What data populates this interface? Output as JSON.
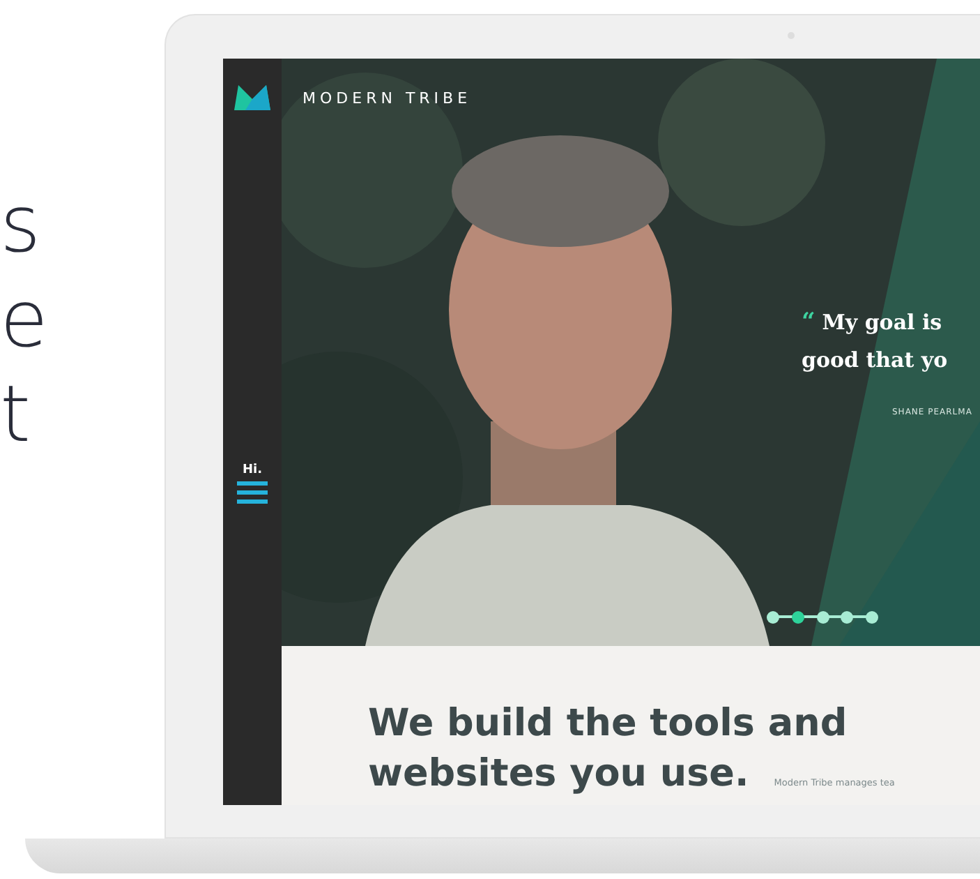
{
  "side_text": [
    "s",
    "e",
    "t"
  ],
  "logo": {
    "text": "MODERN TRIBE"
  },
  "menu": {
    "label": "Hi."
  },
  "quote": {
    "mark": "“",
    "lines": [
      "My goal is",
      "good that yo"
    ],
    "author": "SHANE PEARLMA"
  },
  "slides": [
    {
      "selected": false
    },
    {
      "selected": true
    },
    {
      "selected": false
    },
    {
      "selected": false
    },
    {
      "selected": false
    }
  ],
  "headline": [
    "We build the tools and",
    "websites you use."
  ],
  "intro": "Modern Tribe manages tea"
}
